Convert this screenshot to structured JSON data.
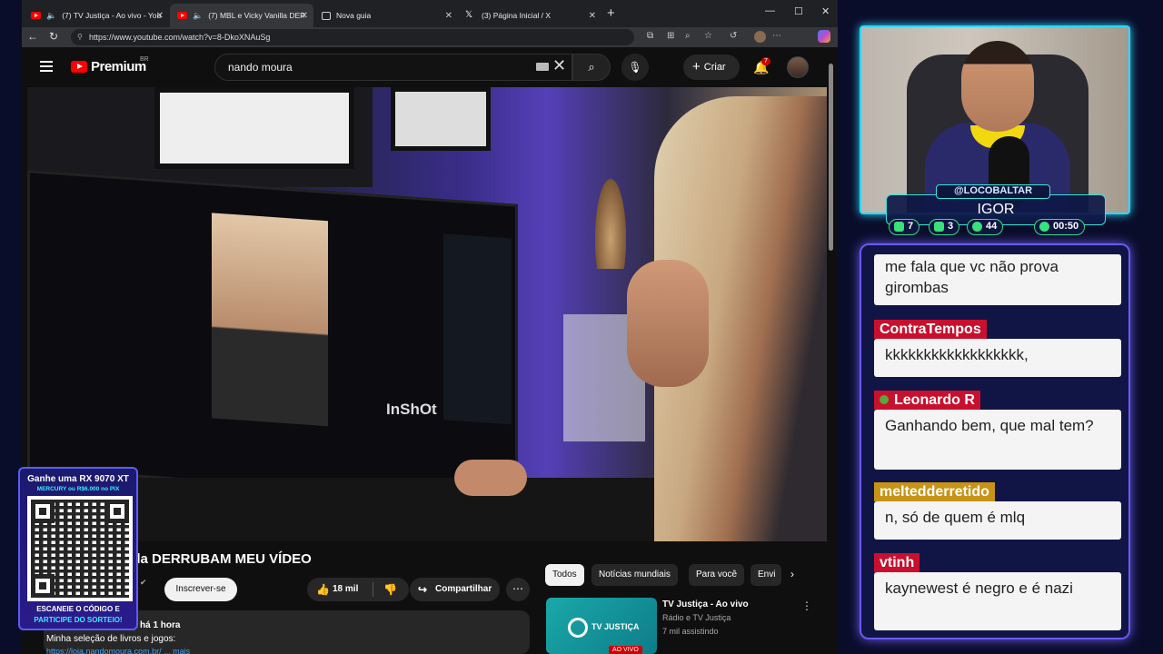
{
  "browser": {
    "tabs": [
      {
        "label": "(7) TV Justiça - Ao vivo - You",
        "icon": "youtube-icon",
        "audio": true
      },
      {
        "label": "(7) MBL e Vicky Vanilla DERR",
        "icon": "youtube-icon",
        "audio": true,
        "active": true
      },
      {
        "label": "Nova guia",
        "icon": "page-icon"
      },
      {
        "label": "(3) Página Inicial / X",
        "icon": "x-icon"
      }
    ],
    "url": "https://www.youtube.com/watch?v=8-DkoXNAuSg"
  },
  "youtube": {
    "brand": "Premium",
    "country": "BR",
    "search_value": "nando moura",
    "create_label": "Criar",
    "notifications_count": "7",
    "video": {
      "watermark": "InShOt",
      "title": "illa DERRUBAM MEU VÍDEO",
      "subscribe_label": "Inscrever-se",
      "likes": "18 mil",
      "share_label": "Compartilhar",
      "desc_time": "há 1 hora",
      "desc_text": "Minha seleção de livros e jogos:",
      "desc_link": "https://loja.nandomoura.com.br/ ... mais"
    },
    "chips": [
      "Todos",
      "Notícias mundiais",
      "Para você",
      "Envi"
    ],
    "recommended": {
      "thumb_text": "TV JUSTIÇA",
      "live_badge": "AO VIVO",
      "title": "TV Justiça - Ao vivo",
      "channel": "Rádio e TV Justiça",
      "views": "7 mil assistindo"
    }
  },
  "promo": {
    "line1": "Ganhe uma RX 9070 XT",
    "line2": "MERCURY ou R$6.000 no PIX",
    "footer1": "ESCANEIE O CÓDIGO E",
    "footer2": "PARTICIPE DO SORTEIO!"
  },
  "stream": {
    "handle": "@LOCOBALTAR",
    "name": "IGOR",
    "stats": [
      {
        "icon": "chat-icon",
        "value": "7",
        "color": "#3ae07a"
      },
      {
        "icon": "youtube-icon",
        "value": "3",
        "color": "#3ae07a"
      },
      {
        "icon": "viewers-icon",
        "value": "44",
        "color": "#3ae07a"
      },
      {
        "icon": "clock-icon",
        "value": "00:50",
        "color": "#3ae07a"
      }
    ]
  },
  "chat": {
    "messages": [
      {
        "user": "",
        "text": "me fala que vc não prova girombas"
      },
      {
        "user": "ContraTempos",
        "text": "kkkkkkkkkkkkkkkkkk,",
        "color": "#c8102e"
      },
      {
        "user": "Leonardo R",
        "text": "Ganhando bem, que mal tem?",
        "color": "#c8102e"
      },
      {
        "user": "meltedderretido",
        "text": "n, só de quem é mlq",
        "color": "#c89418"
      },
      {
        "user": "vtinh",
        "text": "kaynewest é negro e é nazi",
        "color": "#c8102e"
      }
    ]
  }
}
